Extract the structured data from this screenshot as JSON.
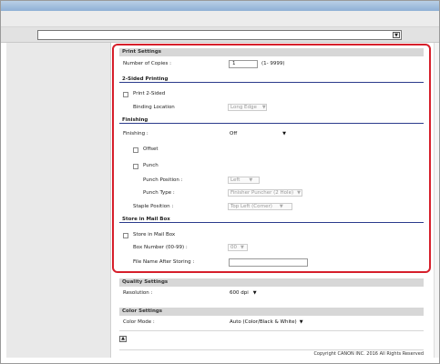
{
  "address_bar": {
    "value": ""
  },
  "print_settings": {
    "title": "Print Settings",
    "number_of_copies": {
      "label": "Number of Copies :",
      "value": "1",
      "hint": "(1- 9999)"
    }
  },
  "two_sided": {
    "title": "2-Sided Printing",
    "print_2_sided_label": "Print 2-Sided",
    "binding_location": {
      "label": "Binding Location",
      "value": "Long Edge"
    }
  },
  "finishing": {
    "title": "Finishing",
    "finishing": {
      "label": "Finishing :",
      "value": "Off"
    },
    "offset_label": "Offset",
    "punch_label": "Punch",
    "punch_position": {
      "label": "Punch Position :",
      "value": "Left"
    },
    "punch_type": {
      "label": "Punch Type :",
      "value": "Finisher Puncher (2 Hole)"
    },
    "staple_position": {
      "label": "Staple Position :",
      "value": "Top Left (Corner)"
    }
  },
  "mailbox": {
    "title": "Store in Mail Box",
    "store_label": "Store in Mail Box",
    "box_number": {
      "label": "Box Number (00-99) :",
      "value": "00"
    },
    "file_name": {
      "label": "File Name After Storing :",
      "value": ""
    }
  },
  "quality": {
    "title": "Quality Settings",
    "resolution": {
      "label": "Resolution :",
      "value": "600 dpi"
    }
  },
  "color": {
    "title": "Color Settings",
    "color_mode": {
      "label": "Color Mode :",
      "value": "Auto (Color/Black & White)"
    }
  },
  "footer": {
    "copyright": "Copyright CANON INC. 2016 All Rights Reserved"
  },
  "icons": {
    "dropdown": "▼",
    "collapse": "▲"
  },
  "colors": {
    "highlight": "#d61f2b",
    "section_rule": "#2b3b8c"
  }
}
